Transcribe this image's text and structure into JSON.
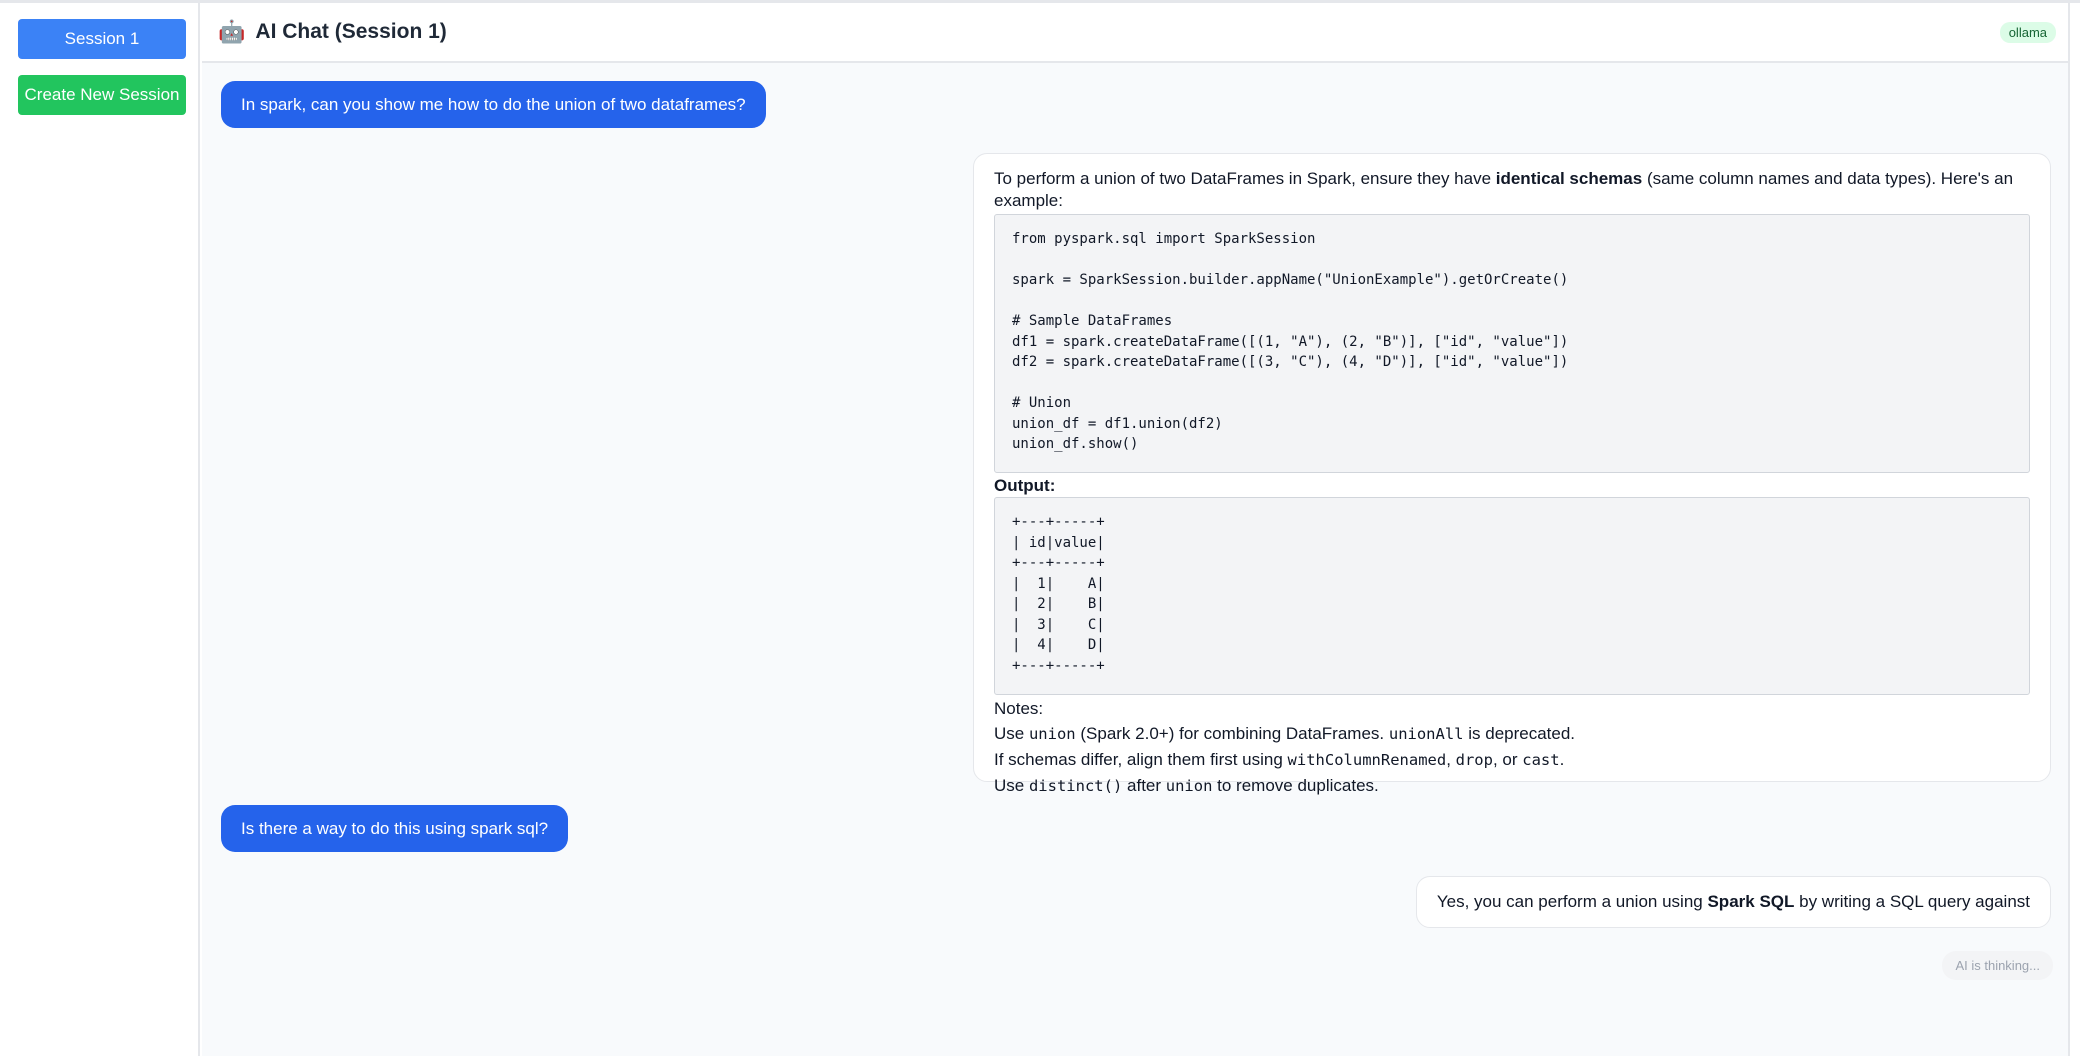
{
  "sidebar": {
    "session_button": "Session 1",
    "new_session_button": "Create New Session"
  },
  "header": {
    "icon": "robot-emoji",
    "robot_glyph": "🤖",
    "title": "AI Chat (Session 1)",
    "badge": "ollama"
  },
  "messages": [
    {
      "role": "user",
      "text": "In spark, can you show me how to do the union of two dataframes?"
    },
    {
      "role": "assistant",
      "intro_prefix": "To perform a union of two DataFrames in Spark, ensure they have ",
      "intro_bold": "identical schemas",
      "intro_suffix": " (same column names and data types). Here's an example:",
      "code": "from pyspark.sql import SparkSession\n\nspark = SparkSession.builder.appName(\"UnionExample\").getOrCreate()\n\n# Sample DataFrames\ndf1 = spark.createDataFrame([(1, \"A\"), (2, \"B\")], [\"id\", \"value\"])\ndf2 = spark.createDataFrame([(3, \"C\"), (4, \"D\")], [\"id\", \"value\"])\n\n# Union\nunion_df = df1.union(df2)\nunion_df.show()",
      "output_label": "Output:",
      "output": "+---+-----+\n| id|value|\n+---+-----+\n|  1|    A|\n|  2|    B|\n|  3|    C|\n|  4|    D|\n+---+-----+",
      "notes_label": "Notes:",
      "note1": {
        "a": "Use ",
        "code1": "union",
        "b": " (Spark 2.0+) for combining DataFrames. ",
        "code2": "unionAll",
        "c": " is deprecated."
      },
      "note2": {
        "a": "If schemas differ, align them first using ",
        "code1": "withColumnRenamed",
        "b": ", ",
        "code2": "drop",
        "c": ", or ",
        "code3": "cast",
        "d": "."
      },
      "note3": {
        "a": "Use ",
        "code1": "distinct()",
        "b": " after ",
        "code2": "union",
        "c": " to remove duplicates."
      }
    },
    {
      "role": "user",
      "text": "Is there a way to do this using spark sql?"
    },
    {
      "role": "assistant",
      "text_prefix": "Yes, you can perform a union using ",
      "text_bold": "Spark SQL",
      "text_suffix": " by writing a SQL query against"
    }
  ],
  "status": {
    "thinking": "AI is thinking..."
  },
  "colors": {
    "user_bubble": "#2563eb",
    "session_button": "#3b82f6",
    "new_session_button": "#22c55e"
  }
}
